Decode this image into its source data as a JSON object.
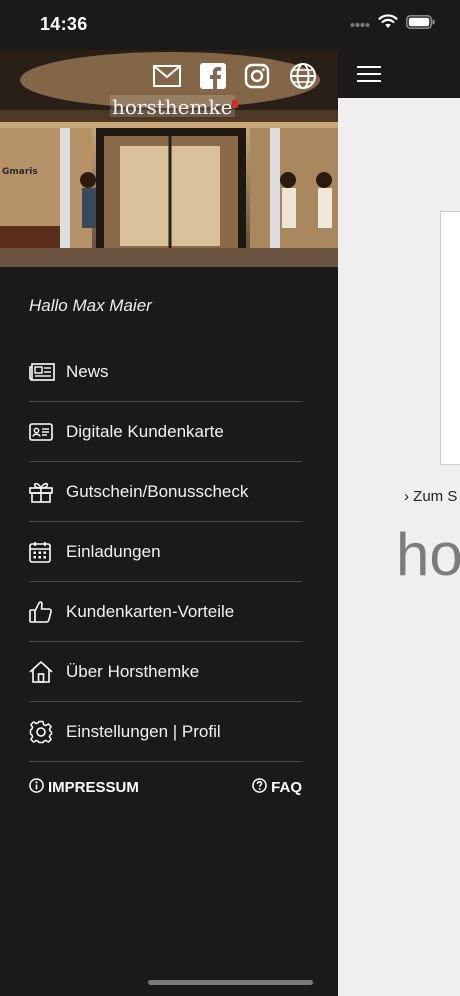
{
  "status_bar": {
    "time": "14:36"
  },
  "store_photo": {
    "sign_text": "horsthemke",
    "side_text": "Gmaris"
  },
  "social_icons": [
    "mail-icon",
    "facebook-icon",
    "instagram-icon",
    "globe-icon"
  ],
  "greeting": "Hallo Max Maier",
  "menu": {
    "items": [
      {
        "label": "News",
        "icon": "newspaper-icon"
      },
      {
        "label": "Digitale Kundenkarte",
        "icon": "id-card-icon"
      },
      {
        "label": "Gutschein/Bonusscheck",
        "icon": "gift-icon"
      },
      {
        "label": "Einladungen",
        "icon": "calendar-icon"
      },
      {
        "label": "Kundenkarten-Vorteile",
        "icon": "thumbs-up-icon"
      },
      {
        "label": "Über Horsthemke",
        "icon": "home-icon"
      },
      {
        "label": "Einstellungen | Profil",
        "icon": "gear-icon"
      }
    ]
  },
  "footer": {
    "impressum": "IMPRESSUM",
    "faq": "FAQ"
  },
  "main": {
    "store_link": "› Zum S",
    "logo_text": "ho"
  },
  "colors": {
    "drawer_bg": "#1a1a1a",
    "text": "#f2f2f2",
    "divider": "#4a4a4a",
    "main_bg": "#efefef"
  }
}
